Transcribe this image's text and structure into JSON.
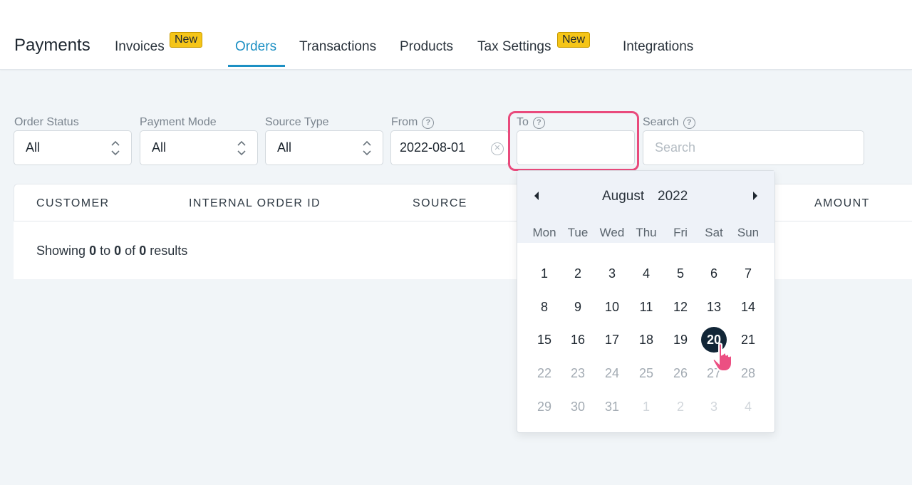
{
  "header": {
    "brand": "Payments",
    "tabs": [
      {
        "label": "Invoices",
        "badge": "New"
      },
      {
        "label": "Orders",
        "active": true
      },
      {
        "label": "Transactions"
      },
      {
        "label": "Products"
      },
      {
        "label": "Tax Settings",
        "badge": "New"
      },
      {
        "label": "Integrations"
      }
    ]
  },
  "filters": {
    "order_status": {
      "label": "Order Status",
      "value": "All"
    },
    "payment_mode": {
      "label": "Payment Mode",
      "value": "All"
    },
    "source_type": {
      "label": "Source Type",
      "value": "All"
    },
    "from": {
      "label": "From",
      "value": "2022-08-01"
    },
    "to": {
      "label": "To",
      "value": ""
    },
    "search": {
      "label": "Search",
      "placeholder": "Search",
      "value": ""
    }
  },
  "table": {
    "columns": [
      "CUSTOMER",
      "INTERNAL ORDER ID",
      "SOURCE",
      "AMOUNT"
    ],
    "results_prefix": "Showing",
    "results_from": "0",
    "results_to_word": "to",
    "results_to": "0",
    "results_of_word": "of",
    "results_total": "0",
    "results_suffix": "results"
  },
  "calendar": {
    "month": "August",
    "year": "2022",
    "weekdays": [
      "Mon",
      "Tue",
      "Wed",
      "Thu",
      "Fri",
      "Sat",
      "Sun"
    ],
    "weeks": [
      [
        "1",
        "2",
        "3",
        "4",
        "5",
        "6",
        "7"
      ],
      [
        "8",
        "9",
        "10",
        "11",
        "12",
        "13",
        "14"
      ],
      [
        "15",
        "16",
        "17",
        "18",
        "19",
        "20",
        "21"
      ],
      [
        "22",
        "23",
        "24",
        "25",
        "26",
        "27",
        "28"
      ],
      [
        "29",
        "30",
        "31",
        "1",
        "2",
        "3",
        "4"
      ]
    ],
    "selected_day": "20"
  },
  "colors": {
    "accent": "#1d90c4",
    "badge": "#f5c518",
    "highlight": "#e94a7c",
    "selected_day": "#122637"
  }
}
